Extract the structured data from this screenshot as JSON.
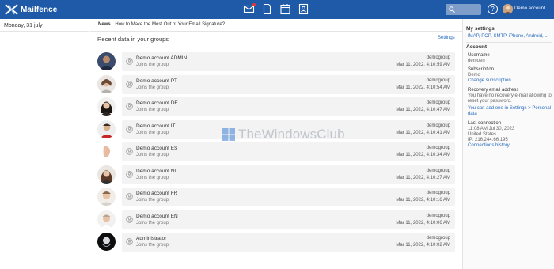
{
  "topbar": {
    "brand": "Mailfence",
    "nav_icons": [
      "mail-icon",
      "document-icon",
      "calendar-icon",
      "contacts-icon"
    ],
    "help": "?",
    "user": "Demo account"
  },
  "left": {
    "date": "Monday, 31 july"
  },
  "news": {
    "label": "News",
    "text": "How to Make the Most Out of Your Email Signature?"
  },
  "main": {
    "title": "Recent data in your groups",
    "settings": "Settings",
    "rows": [
      {
        "name": "Demo account ADMIN",
        "action": "Joins the group",
        "group": "demogroup",
        "time": "Mar 11, 2022, 4:10:59 AM"
      },
      {
        "name": "Demo account PT",
        "action": "Joins the group",
        "group": "demogroup",
        "time": "Mar 11, 2022, 4:10:54 AM"
      },
      {
        "name": "Demo account DE",
        "action": "Joins the group",
        "group": "demogroup",
        "time": "Mar 11, 2022, 4:10:47 AM"
      },
      {
        "name": "Demo account IT",
        "action": "Joins the group",
        "group": "demogroup",
        "time": "Mar 11, 2022, 4:10:41 AM"
      },
      {
        "name": "Demo account ES",
        "action": "Joins the group",
        "group": "demogroup",
        "time": "Mar 11, 2022, 4:10:34 AM"
      },
      {
        "name": "Demo account NL",
        "action": "Joins the group",
        "group": "demogroup",
        "time": "Mar 11, 2022, 4:10:27 AM"
      },
      {
        "name": "Demo account FR",
        "action": "Joins the group",
        "group": "demogroup",
        "time": "Mar 11, 2022, 4:10:16 AM"
      },
      {
        "name": "Demo account EN",
        "action": "Joins the group",
        "group": "demogroup",
        "time": "Mar 11, 2022, 4:10:06 AM"
      },
      {
        "name": "Administrator",
        "action": "Joins the group",
        "group": "demogroup",
        "time": "Mar 11, 2022, 4:10:02 AM"
      }
    ]
  },
  "watermark": "TheWindowsClub",
  "right": {
    "my_settings": "My settings",
    "protocols": "IMAP, POP, SMTP, iPhone, Android, ...",
    "account": "Account",
    "username_label": "Username",
    "username": "demoen",
    "subscription_label": "Subscription",
    "subscription": "Demo",
    "change_subscription": "Change subscription",
    "recovery_label": "Recovery email address",
    "recovery_line1": "You have no recovery e-mail allowing to",
    "recovery_line2": "reset your password.",
    "recovery_link1": "You can add one in Settings > Personal",
    "recovery_link2": "data",
    "last_conn_label": "Last connection",
    "last_conn_time": "11:08 AM Jul 30, 2023",
    "last_conn_country": "United States",
    "last_conn_ip": "IP: 216.244.66.195",
    "connections_history": "Connections history"
  },
  "colors": {
    "topbar": "#1e5aa8",
    "link": "#2a6bbf"
  }
}
